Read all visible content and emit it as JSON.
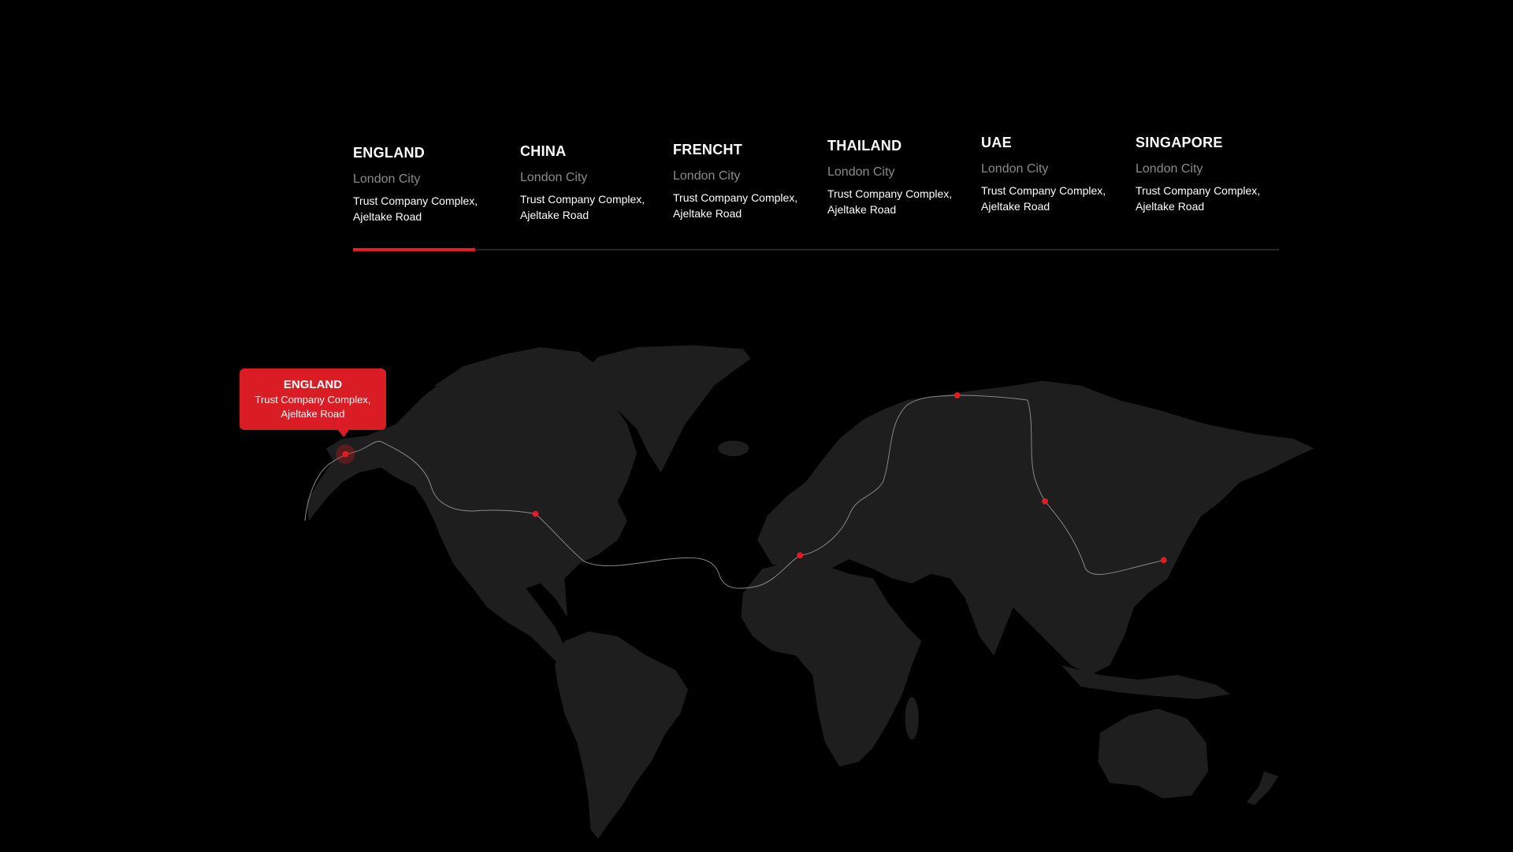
{
  "colors": {
    "background": "#000000",
    "accent": "#e31b23",
    "land": "#1e1e1e",
    "route": "#8a8a8a",
    "muted_text": "#8a8a8a"
  },
  "tabs": [
    {
      "country": "ENGLAND",
      "city": "London City",
      "address_line1": "Trust Company Complex,",
      "address_line2": "Ajeltake Road",
      "active": true
    },
    {
      "country": "CHINA",
      "city": "London City",
      "address_line1": "Trust Company Complex,",
      "address_line2": "Ajeltake Road",
      "active": false
    },
    {
      "country": "FRENCHT",
      "city": "London City",
      "address_line1": "Trust Company Complex,",
      "address_line2": "Ajeltake Road",
      "active": false
    },
    {
      "country": "THAILAND",
      "city": "London City",
      "address_line1": "Trust Company Complex,",
      "address_line2": "Ajeltake Road",
      "active": false
    },
    {
      "country": "UAE",
      "city": "London City",
      "address_line1": "Trust Company Complex,",
      "address_line2": "Ajeltake Road",
      "active": false
    },
    {
      "country": "SINGAPORE",
      "city": "London City",
      "address_line1": "Trust Company Complex,",
      "address_line2": "Ajeltake Road",
      "active": false
    }
  ],
  "map": {
    "tooltip": {
      "title": "ENGLAND",
      "address_line1": "Trust Company Complex,",
      "address_line2": "Ajeltake Road"
    },
    "markers": [
      {
        "name": "marker-alaska",
        "active": true
      },
      {
        "name": "marker-great-lakes",
        "active": false
      },
      {
        "name": "marker-algeria",
        "active": false
      },
      {
        "name": "marker-novaya-zemlya",
        "active": false
      },
      {
        "name": "marker-siberia",
        "active": false
      },
      {
        "name": "marker-japan",
        "active": false
      }
    ]
  }
}
